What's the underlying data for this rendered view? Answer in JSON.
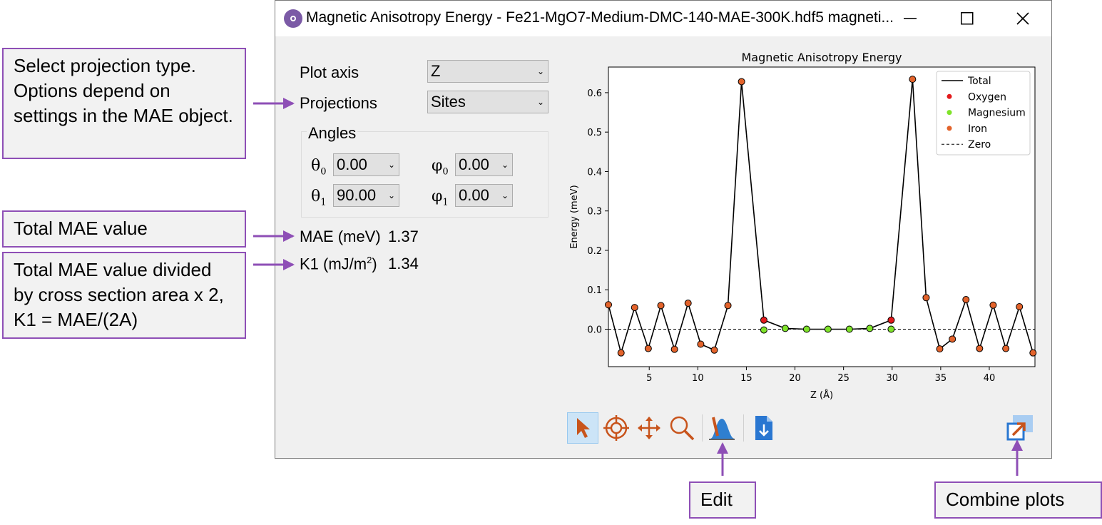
{
  "window": {
    "title": "Magnetic Anisotropy Energy - Fe21-MgO7-Medium-DMC-140-MAE-300K.hdf5 magneti...",
    "minimize_icon": "minimize-icon",
    "maximize_icon": "maximize-icon",
    "close_icon": "close-icon"
  },
  "controls": {
    "plot_axis_label": "Plot axis",
    "plot_axis_value": "Z",
    "projections_label": "Projections",
    "projections_value": "Sites",
    "angles_title": "Angles",
    "theta0_value": "0.00",
    "phi0_value": "0.00",
    "theta1_value": "90.00",
    "phi1_value": "0.00",
    "mae_label": "MAE (meV)",
    "mae_value": "1.37",
    "k1_label": "K1 (mJ/m",
    "k1_label_sup": "2",
    "k1_label_end": ")",
    "k1_value": "1.34"
  },
  "callouts": {
    "projection": "Select projection type. Options depend on settings in the MAE object.",
    "total_mae": "Total MAE value",
    "k1": "Total MAE value divided by cross section area x 2, K1 = MAE/(2A)",
    "edit": "Edit",
    "combine": "Combine plots"
  },
  "toolbar": {
    "icons": [
      "pointer-icon",
      "crosshair-icon",
      "pan-icon",
      "zoom-icon",
      "edit-plot-icon",
      "export-icon",
      "combine-plots-icon"
    ]
  },
  "colors": {
    "accent": "#8e4fb6",
    "oxygen": "#e31a1c",
    "magnesium": "#7fe32a",
    "iron": "#e3632b"
  },
  "chart_data": {
    "type": "line",
    "title": "Magnetic Anisotropy Energy",
    "xlabel": "Z (Å)",
    "ylabel": "Energy (meV)",
    "xlim": [
      0.8,
      44.7
    ],
    "ylim": [
      -0.095,
      0.665
    ],
    "xticks": [
      5,
      10,
      15,
      20,
      25,
      30,
      35,
      40
    ],
    "yticks": [
      0.0,
      0.1,
      0.2,
      0.3,
      0.4,
      0.5,
      0.6
    ],
    "legend": [
      "Total",
      "Oxygen",
      "Magnesium",
      "Iron",
      "Zero"
    ],
    "legend_position": "top-right",
    "series": [
      {
        "name": "Total",
        "x": [
          0.8,
          2.1,
          3.5,
          4.9,
          6.2,
          7.6,
          9.0,
          10.3,
          11.7,
          13.1,
          14.5,
          16.8,
          19.0,
          21.2,
          23.4,
          25.6,
          27.7,
          29.9,
          32.1,
          33.5,
          34.9,
          36.2,
          37.6,
          39.0,
          40.4,
          41.7,
          43.1,
          44.5
        ],
        "y": [
          0.062,
          -0.06,
          0.055,
          -0.049,
          0.06,
          -0.051,
          0.066,
          -0.038,
          -0.053,
          0.06,
          0.628,
          0.023,
          0.002,
          0.0,
          0.0,
          0.0,
          0.002,
          0.023,
          0.634,
          0.08,
          -0.05,
          -0.025,
          0.075,
          -0.049,
          0.061,
          -0.049,
          0.057,
          -0.06
        ]
      },
      {
        "name": "Oxygen",
        "x": [
          16.8,
          29.9
        ],
        "y": [
          0.023,
          0.023
        ]
      },
      {
        "name": "Magnesium",
        "x": [
          16.8,
          19.0,
          21.2,
          23.4,
          25.6,
          27.7,
          29.9
        ],
        "y": [
          -0.002,
          0.002,
          0.0,
          0.0,
          0.0,
          0.002,
          0.0
        ]
      },
      {
        "name": "Iron",
        "x": [
          0.8,
          2.1,
          3.5,
          4.9,
          6.2,
          7.6,
          9.0,
          10.3,
          11.7,
          13.1,
          14.5,
          32.1,
          33.5,
          34.9,
          36.2,
          37.6,
          39.0,
          40.4,
          41.7,
          43.1,
          44.5
        ],
        "y": [
          0.062,
          -0.06,
          0.055,
          -0.049,
          0.06,
          -0.051,
          0.066,
          -0.038,
          -0.053,
          0.06,
          0.628,
          0.634,
          0.08,
          -0.05,
          -0.025,
          0.075,
          -0.049,
          0.061,
          -0.049,
          0.057,
          -0.06
        ]
      },
      {
        "name": "Zero",
        "x": [
          0.8,
          44.7
        ],
        "y": [
          0,
          0
        ]
      }
    ]
  }
}
